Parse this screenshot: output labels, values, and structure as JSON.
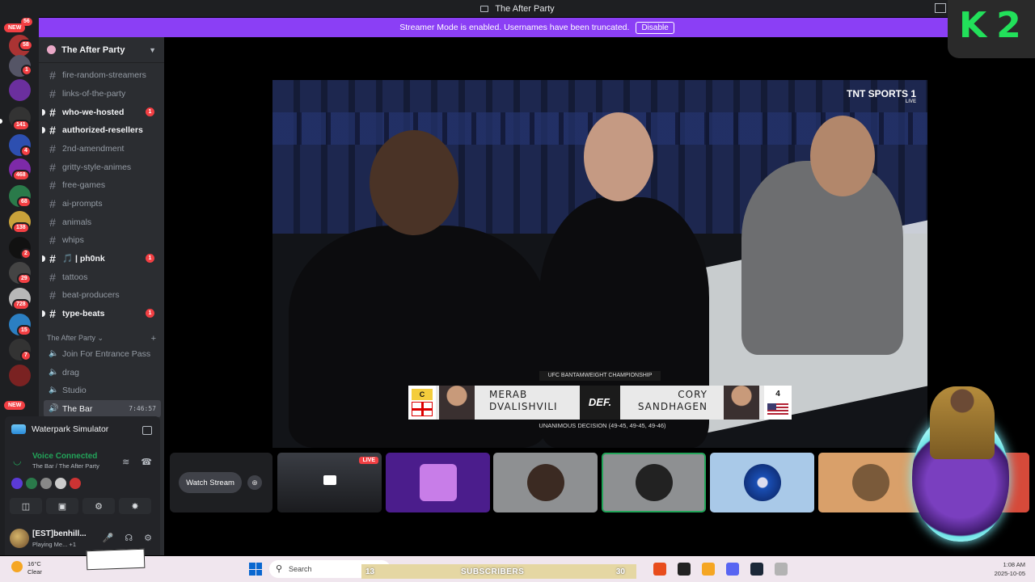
{
  "window": {
    "title": "The After Party"
  },
  "banner": {
    "text": "Streamer Mode is enabled. Usernames have been truncated.",
    "disable_label": "Disable"
  },
  "server_rail": {
    "badges": [
      "56",
      "NEW",
      "58",
      "1",
      "141",
      "4",
      "468",
      "68",
      "138",
      "2",
      "29",
      "728",
      "15",
      "7",
      "NEW"
    ],
    "accent": "#f23f43"
  },
  "server": {
    "name": "The After Party",
    "channels": [
      {
        "name": "fire-random-streamers",
        "unread": false
      },
      {
        "name": "links-of-the-party",
        "unread": false
      },
      {
        "name": "who-we-hosted",
        "unread": true,
        "mentions": "1"
      },
      {
        "name": "authorized-resellers",
        "unread": true
      },
      {
        "name": "2nd-amendment",
        "unread": false
      },
      {
        "name": "gritty-style-animes",
        "unread": false
      },
      {
        "name": "free-games",
        "unread": false
      },
      {
        "name": "ai-prompts",
        "unread": false
      },
      {
        "name": "animals",
        "unread": false
      },
      {
        "name": "whips",
        "unread": false
      },
      {
        "name": "🎵 | ph0nk",
        "unread": true,
        "mentions": "1"
      },
      {
        "name": "tattoos",
        "unread": false
      },
      {
        "name": "beat-producers",
        "unread": false
      },
      {
        "name": "type-beats",
        "unread": true,
        "mentions": "1"
      }
    ],
    "category": "The After Party",
    "voice_channels": [
      {
        "name": "Join For Entrance Pass"
      },
      {
        "name": "drag"
      },
      {
        "name": "Studio"
      },
      {
        "name": "The Bar",
        "timer": "7:46:57",
        "active": true
      }
    ]
  },
  "activity": {
    "game": "Waterpark Simulator",
    "voice_status": "Voice Connected",
    "voice_location": "The Bar / The After Party"
  },
  "user": {
    "name": "[EST]benhill...",
    "status": "Playing Me... +1"
  },
  "stream": {
    "network": "TNT SPORTS 1",
    "network_sub": "LIVE",
    "championship": "UFC BANTAMWEIGHT CHAMPIONSHIP",
    "champ_badge": "C",
    "winner": "MERAB DVALISHVILI",
    "def_label": "DEF.",
    "loser": "CORY SANDHAGEN",
    "loser_rank": "4",
    "result": "UNANIMOUS DECISION (49-45, 49-45, 49-46)"
  },
  "watch_stream_label": "Watch Stream",
  "thumb_live_label": "LIVE",
  "overlay": {
    "logo_text": "K2"
  },
  "taskbar": {
    "temp": "16°C",
    "weather": "Clear",
    "search_placeholder": "Search",
    "subs_count": "13",
    "subs_label": "SUBSCRIBERS",
    "subs_count2": "30",
    "time": "1:08 AM",
    "date": "2025-10-05"
  }
}
